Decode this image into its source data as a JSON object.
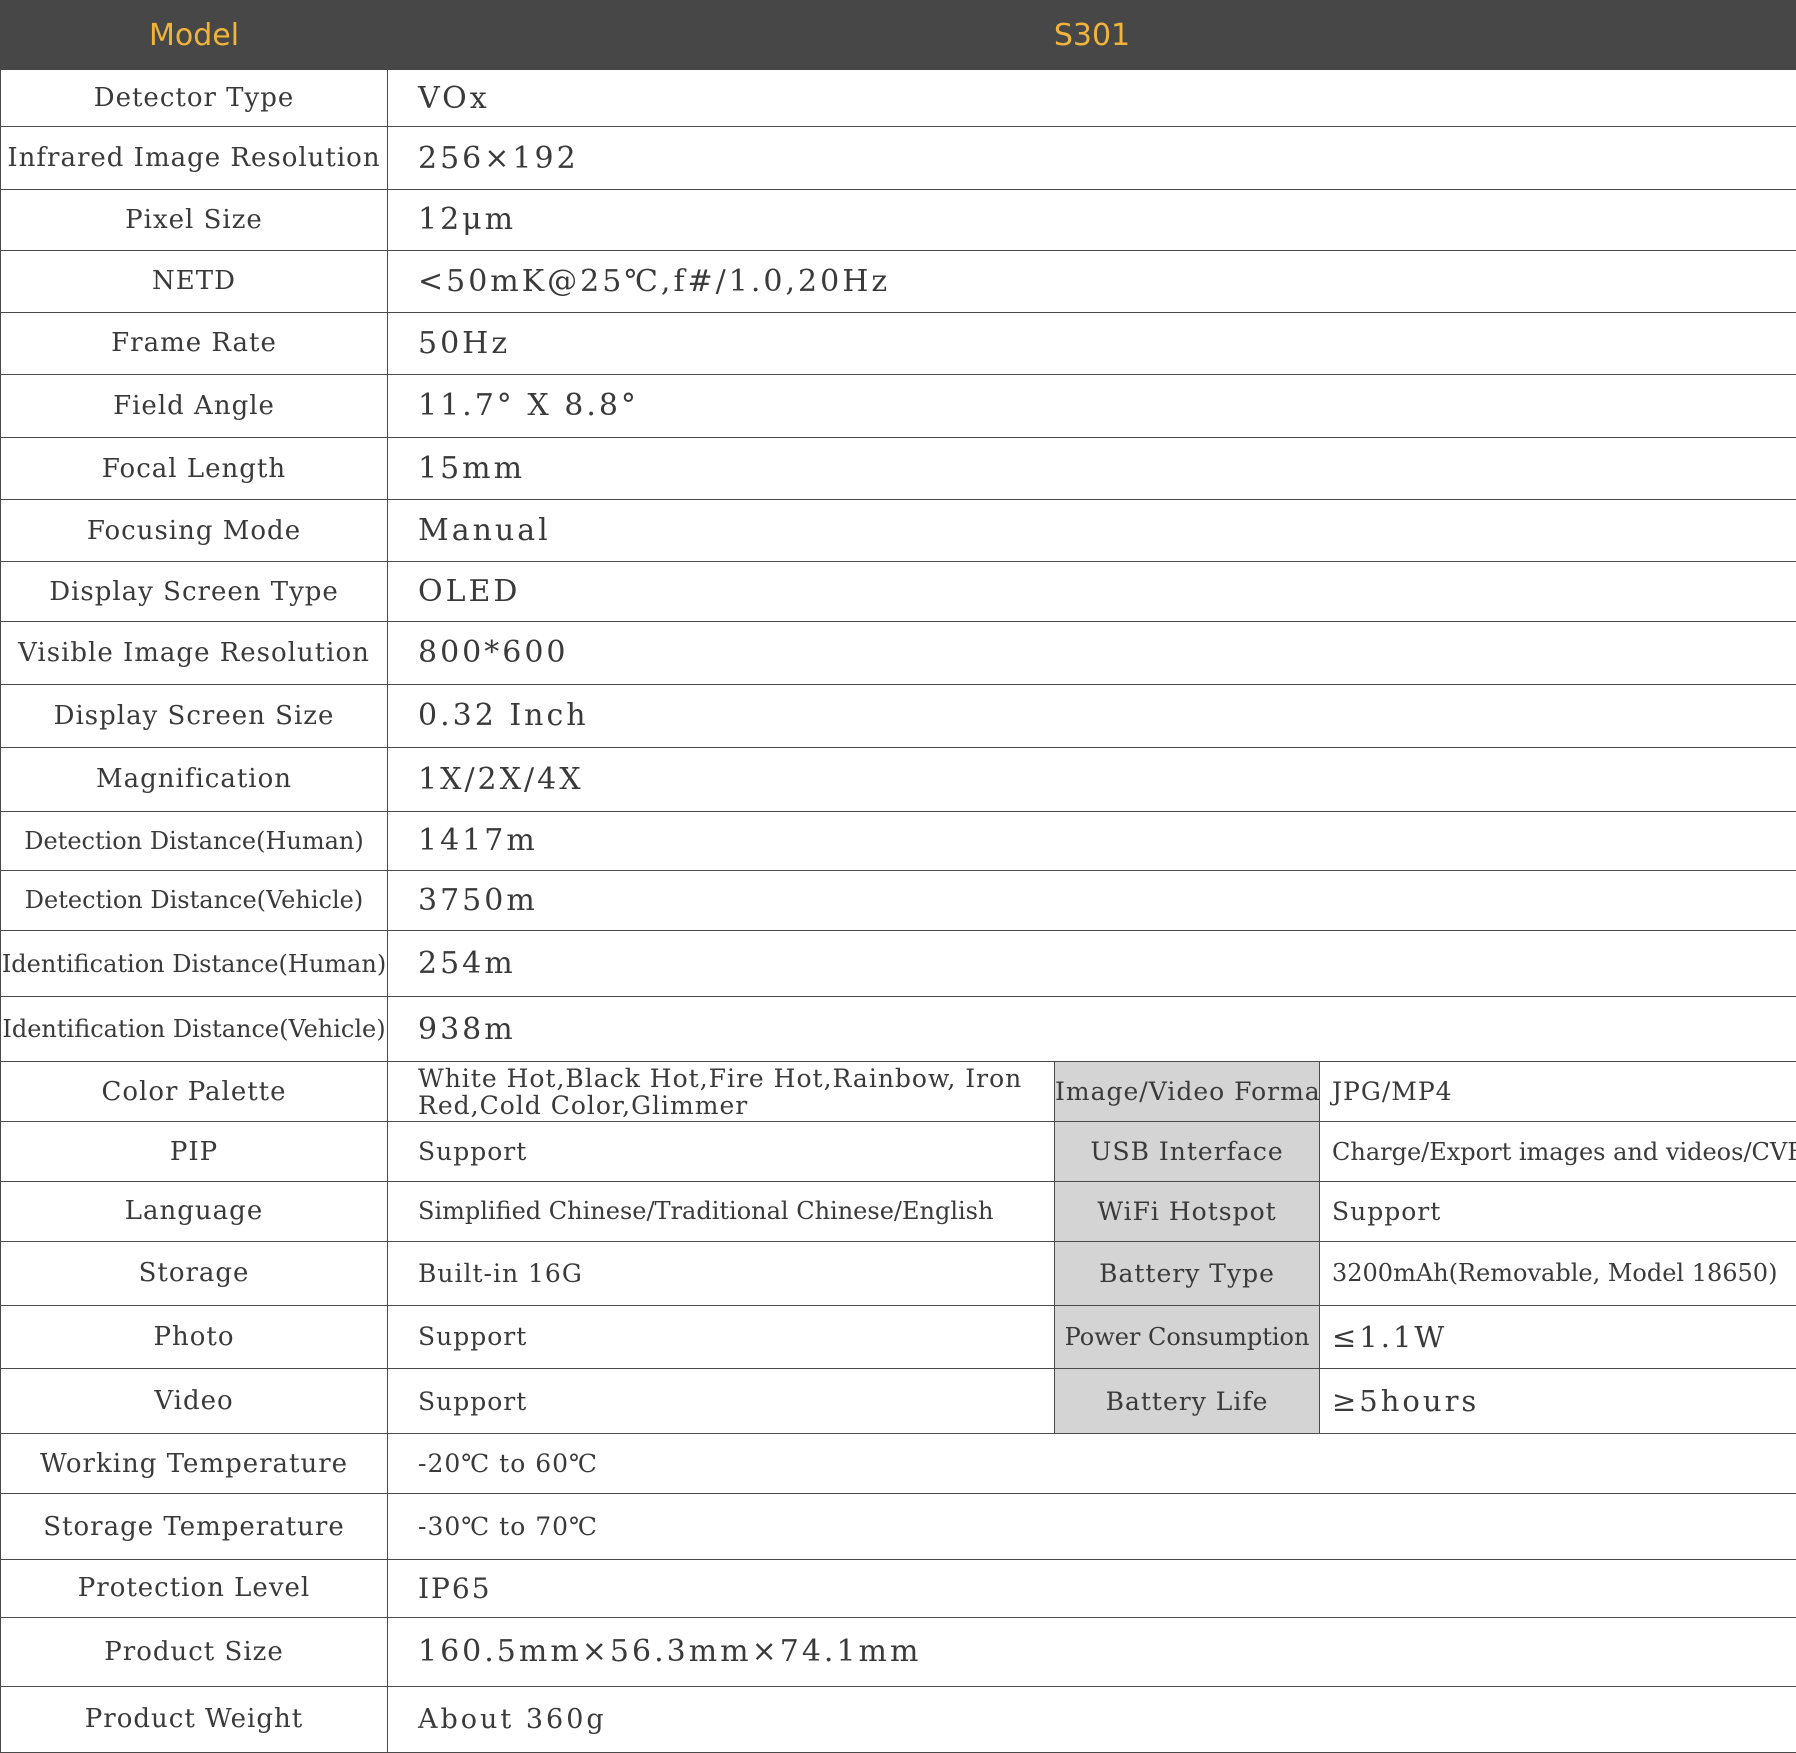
{
  "header": {
    "model_label": "Model",
    "model_value": "S301"
  },
  "rows": [
    {
      "label": "Detector Type",
      "value": "VOx"
    },
    {
      "label": "Infrared Image Resolution",
      "value": "256×192"
    },
    {
      "label": "Pixel Size",
      "value": "12μm"
    },
    {
      "label": "NETD",
      "value": "<50mK@25℃,f#/1.0,20Hz"
    },
    {
      "label": "Frame Rate",
      "value": "50Hz"
    },
    {
      "label": "Field Angle",
      "value": "11.7° X 8.8°"
    },
    {
      "label": "Focal Length",
      "value": "15mm"
    },
    {
      "label": "Focusing Mode",
      "value": "Manual"
    },
    {
      "label": "Display Screen Type",
      "value": "OLED"
    },
    {
      "label": "Visible Image Resolution",
      "value": "800*600"
    },
    {
      "label": "Display Screen Size",
      "value": "0.32 Inch"
    },
    {
      "label": "Magnification",
      "value": "1X/2X/4X"
    },
    {
      "label": "Detection Distance(Human)",
      "value": "1417m"
    },
    {
      "label": "Detection Distance(Vehicle)",
      "value": "3750m"
    },
    {
      "label": "Identification Distance(Human)",
      "value": "254m"
    },
    {
      "label": "Identification Distance(Vehicle)",
      "value": "938m"
    }
  ],
  "split_rows": [
    {
      "label": "Color Palette",
      "value": "White Hot,Black Hot,Fire Hot,Rainbow, Iron Red,Cold Color,Glimmer",
      "label2": "Image/Video Format",
      "value2": "JPG/MP4"
    },
    {
      "label": "PIP",
      "value": "Support",
      "label2": "USB Interface",
      "value2": "Charge/Export images and videos/CVBS"
    },
    {
      "label": "Language",
      "value": "Simplified Chinese/Traditional Chinese/English",
      "label2": "WiFi Hotspot",
      "value2": "Support"
    },
    {
      "label": "Storage",
      "value": "Built-in 16G",
      "label2": "Battery Type",
      "value2": "3200mAh(Removable, Model 18650)"
    },
    {
      "label": "Photo",
      "value": "Support",
      "label2": "Power Consumption",
      "value2": "≤1.1W"
    },
    {
      "label": "Video",
      "value": "Support",
      "label2": "Battery Life",
      "value2": "≥5hours"
    }
  ],
  "bottom_rows": [
    {
      "label": "Working Temperature",
      "value": "-20℃ to 60℃"
    },
    {
      "label": "Storage Temperature",
      "value": "-30℃ to 70℃"
    },
    {
      "label": "Protection Level",
      "value": "IP65"
    },
    {
      "label": "Product Size",
      "value": "160.5mm×56.3mm×74.1mm"
    },
    {
      "label": "Product Weight",
      "value": "About 360g"
    }
  ],
  "colors": {
    "header_bg": "#474747",
    "header_text": "#f0b43c",
    "sub_label_bg": "#d4d4d4",
    "text": "#3a3a3a"
  }
}
